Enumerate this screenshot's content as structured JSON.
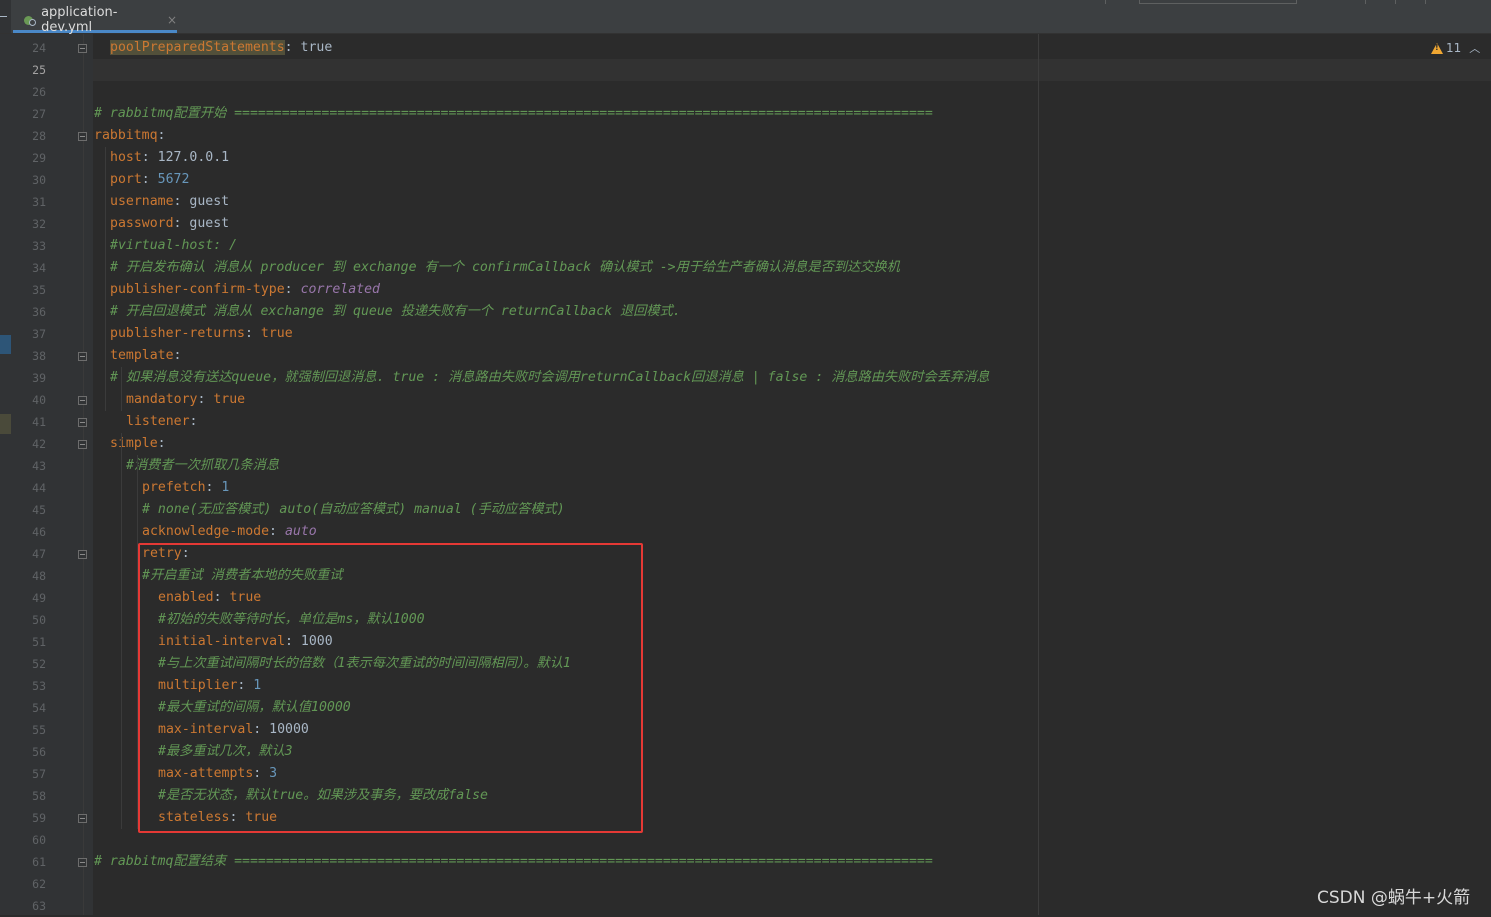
{
  "tab": {
    "filename": "application-dev.yml",
    "close": "×"
  },
  "inspections": {
    "warning_count": "11"
  },
  "watermark": "CSDN @蜗牛+火箭",
  "current_line": "25",
  "lines": [
    {
      "num": "24",
      "segs": [
        [
          "k hl",
          "poolPreparedStatements"
        ],
        [
          "v",
          ": true"
        ]
      ]
    },
    {
      "num": "25",
      "segs": []
    },
    {
      "num": "26",
      "segs": []
    },
    {
      "num": "27",
      "segs": [
        [
          "c",
          "# rabbitmq配置开始 ========================================================================================"
        ]
      ]
    },
    {
      "num": "28",
      "segs": [
        [
          "k",
          "rabbitmq"
        ],
        [
          "v",
          ":"
        ]
      ]
    },
    {
      "num": "29",
      "segs": [
        [
          "k",
          "host"
        ],
        [
          "v",
          ": 127.0.0.1"
        ]
      ]
    },
    {
      "num": "30",
      "segs": [
        [
          "k",
          "port"
        ],
        [
          "v",
          ": "
        ],
        [
          "n",
          "5672"
        ]
      ]
    },
    {
      "num": "31",
      "segs": [
        [
          "k",
          "username"
        ],
        [
          "v",
          ": guest"
        ]
      ]
    },
    {
      "num": "32",
      "segs": [
        [
          "k",
          "password"
        ],
        [
          "v",
          ": guest"
        ]
      ]
    },
    {
      "num": "33",
      "segs": [
        [
          "c",
          "#virtual-host: /"
        ]
      ]
    },
    {
      "num": "34",
      "segs": [
        [
          "c",
          "# 开启发布确认 消息从 producer 到 exchange 有一个 confirmCallback 确认模式 ->用于给生产者确认消息是否到达交换机"
        ]
      ]
    },
    {
      "num": "35",
      "segs": [
        [
          "k",
          "publisher-confirm-type"
        ],
        [
          "v",
          ": "
        ],
        [
          "p",
          "correlated"
        ]
      ]
    },
    {
      "num": "36",
      "segs": [
        [
          "c",
          "# 开启回退模式 消息从 exchange 到 queue 投递失败有一个 returnCallback 退回模式."
        ]
      ]
    },
    {
      "num": "37",
      "segs": [
        [
          "k",
          "publisher-returns"
        ],
        [
          "v",
          ": "
        ],
        [
          "k",
          "true"
        ]
      ]
    },
    {
      "num": "38",
      "segs": [
        [
          "k",
          "template"
        ],
        [
          "v",
          ":"
        ]
      ]
    },
    {
      "num": "39",
      "segs": [
        [
          "c",
          "# 如果消息没有送达queue，就强制回退消息. true : 消息路由失败时会调用returnCallback回退消息 | false : 消息路由失败时会丢弃消息"
        ]
      ]
    },
    {
      "num": "40",
      "segs": [
        [
          "k",
          "mandatory"
        ],
        [
          "v",
          ": "
        ],
        [
          "k",
          "true"
        ]
      ]
    },
    {
      "num": "41",
      "segs": [
        [
          "k",
          "listener"
        ],
        [
          "v",
          ":"
        ]
      ]
    },
    {
      "num": "42",
      "segs": [
        [
          "k",
          "simple"
        ],
        [
          "v",
          ":"
        ]
      ]
    },
    {
      "num": "43",
      "segs": [
        [
          "c",
          "#消费者一次抓取几条消息"
        ]
      ]
    },
    {
      "num": "44",
      "segs": [
        [
          "k",
          "prefetch"
        ],
        [
          "v",
          ": "
        ],
        [
          "n",
          "1"
        ]
      ]
    },
    {
      "num": "45",
      "segs": [
        [
          "c",
          "# none(无应答模式) auto(自动应答模式) manual (手动应答模式)"
        ]
      ]
    },
    {
      "num": "46",
      "segs": [
        [
          "k",
          "acknowledge-mode"
        ],
        [
          "v",
          ": "
        ],
        [
          "p",
          "auto"
        ]
      ]
    },
    {
      "num": "47",
      "segs": [
        [
          "k",
          "retry"
        ],
        [
          "v",
          ":"
        ]
      ]
    },
    {
      "num": "48",
      "segs": [
        [
          "c",
          "#开启重试 消费者本地的失败重试"
        ]
      ]
    },
    {
      "num": "49",
      "segs": [
        [
          "k",
          "enabled"
        ],
        [
          "v",
          ": "
        ],
        [
          "k",
          "true"
        ]
      ]
    },
    {
      "num": "50",
      "segs": [
        [
          "c",
          "#初始的失败等待时长，单位是ms，默认1000"
        ]
      ]
    },
    {
      "num": "51",
      "segs": [
        [
          "k",
          "initial-interval"
        ],
        [
          "v",
          ": 1000"
        ]
      ]
    },
    {
      "num": "52",
      "segs": [
        [
          "c",
          "#与上次重试间隔时长的倍数（1表示每次重试的时间间隔相同）。默认1"
        ]
      ]
    },
    {
      "num": "53",
      "segs": [
        [
          "k",
          "multiplier"
        ],
        [
          "v",
          ": "
        ],
        [
          "n",
          "1"
        ]
      ]
    },
    {
      "num": "54",
      "segs": [
        [
          "c",
          "#最大重试的间隔，默认值10000"
        ]
      ]
    },
    {
      "num": "55",
      "segs": [
        [
          "k",
          "max-interval"
        ],
        [
          "v",
          ": 10000"
        ]
      ]
    },
    {
      "num": "56",
      "segs": [
        [
          "c",
          "#最多重试几次，默认3"
        ]
      ]
    },
    {
      "num": "57",
      "segs": [
        [
          "k",
          "max-attempts"
        ],
        [
          "v",
          ": "
        ],
        [
          "n",
          "3"
        ]
      ]
    },
    {
      "num": "58",
      "segs": [
        [
          "c",
          "#是否无状态，默认true。如果涉及事务，要改成false"
        ]
      ]
    },
    {
      "num": "59",
      "segs": [
        [
          "k",
          "stateless"
        ],
        [
          "v",
          ": "
        ],
        [
          "k",
          "true"
        ]
      ]
    },
    {
      "num": "60",
      "segs": []
    },
    {
      "num": "61",
      "segs": [
        [
          "c",
          "# rabbitmq配置结束 ========================================================================================"
        ]
      ]
    },
    {
      "num": "62",
      "segs": []
    },
    {
      "num": "63",
      "segs": []
    }
  ]
}
